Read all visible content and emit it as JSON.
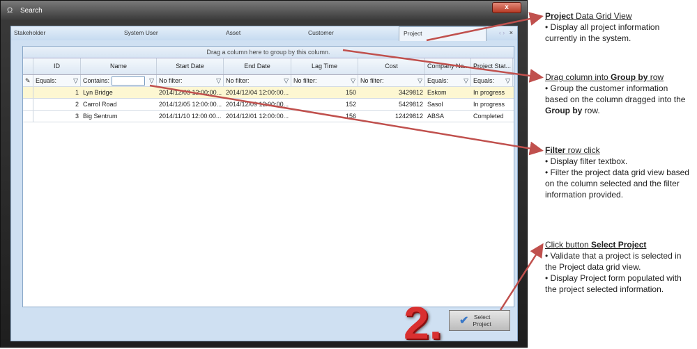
{
  "window": {
    "title": "Search",
    "close": "x"
  },
  "tabs": [
    "Stakeholder",
    "System User",
    "Asset",
    "Customer",
    "Project"
  ],
  "tab_nav": {
    "prev": "‹",
    "next": "›",
    "close": "×"
  },
  "grid": {
    "group_hint": "Drag a column here to group by this column.",
    "columns": [
      "ID",
      "Name",
      "Start Date",
      "End Date",
      "Lag Time",
      "Cost",
      "Company Na...",
      "Project Stat..."
    ],
    "filters": [
      "Equals:",
      "Contains:",
      "No filter:",
      "No filter:",
      "No filter:",
      "No filter:",
      "Equals:",
      "Equals:"
    ],
    "rows": [
      [
        "1",
        "Lyn Bridge",
        "2014/12/03 12:00:00...",
        "2014/12/04 12:00:00...",
        "150",
        "3429812",
        "Eskom",
        "In progress"
      ],
      [
        "2",
        "Carrol Road",
        "2014/12/05 12:00:00...",
        "2014/12/09 12:00:00...",
        "152",
        "5429812",
        "Sasol",
        "In progress"
      ],
      [
        "3",
        "Big Sentrum",
        "2014/11/10 12:00:00...",
        "2014/12/01 12:00:00...",
        "156",
        "12429812",
        "ABSA",
        "Completed"
      ]
    ]
  },
  "button": {
    "line1": "Select",
    "line2": "Project"
  },
  "step_label": "2.",
  "notes": [
    {
      "title_bold": "Project",
      "title_rest": " Data Grid View",
      "bullets": [
        "• Display all project information currently in the system."
      ]
    },
    {
      "title_a": "Drag column into ",
      "title_bold": "Group by",
      "title_c": " row",
      "bullet_a": "• Group the customer information based on the column dragged into the ",
      "bullet_bold": "Group  by",
      "bullet_c": " row."
    },
    {
      "title_bold": "Filter",
      "title_rest": " row click",
      "bullets": [
        "• Display filter textbox.",
        "• Filter the project data grid view based on the column selected and the filter information provided."
      ]
    },
    {
      "title_a": "Click button ",
      "title_bold": "Select Project",
      "bullets": [
        "• Validate that a project is selected in the Project data grid view.",
        "• Display Project form populated with the project selected information."
      ]
    }
  ]
}
